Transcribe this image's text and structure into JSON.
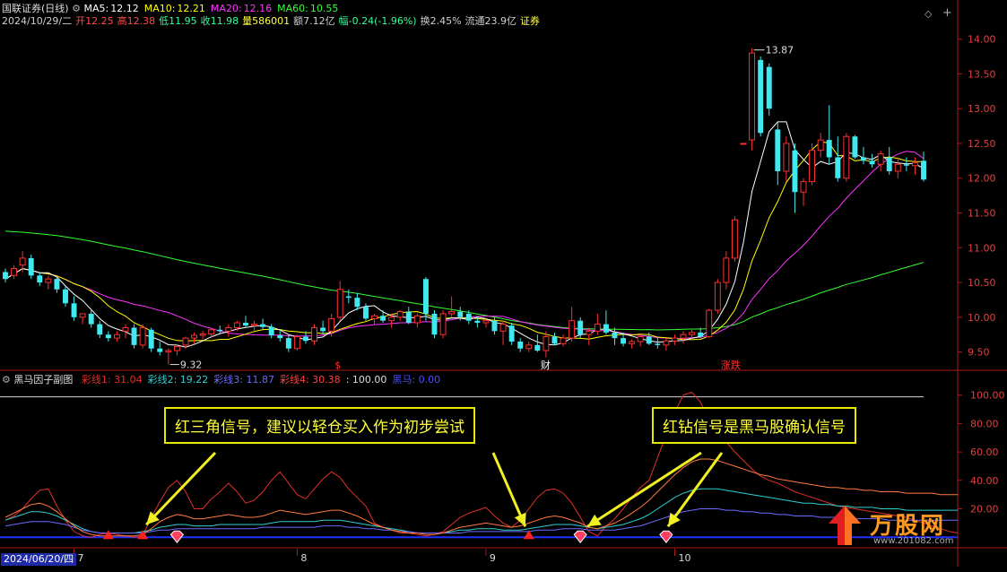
{
  "header": {
    "stock": "国联证券",
    "period": "(日线)",
    "ma": [
      {
        "label": "MA5:",
        "value": "12.12",
        "color": "#ffffff"
      },
      {
        "label": "MA10:",
        "value": "12.21",
        "color": "#ffff00"
      },
      {
        "label": "MA20:",
        "value": "12.16",
        "color": "#ff33ff"
      },
      {
        "label": "MA60:",
        "value": "10.55",
        "color": "#33ff33"
      }
    ],
    "info": [
      {
        "text": "2024/10/29/二",
        "color": "#cfcfcf"
      },
      {
        "text": "开12.25",
        "color": "#ff4a4a"
      },
      {
        "text": "高12.38",
        "color": "#ff4a4a"
      },
      {
        "text": "低11.95",
        "color": "#33ff99"
      },
      {
        "text": "收11.98",
        "color": "#33ff99"
      },
      {
        "text": "量586001",
        "color": "#ffff44"
      },
      {
        "text": "额7.12亿",
        "color": "#cfcfcf"
      },
      {
        "text": "幅-0.24(-1.96%)",
        "color": "#33ff99"
      },
      {
        "text": "换2.45%",
        "color": "#cfcfcf"
      },
      {
        "text": "流通23.9亿",
        "color": "#cfcfcf"
      },
      {
        "text": "证券",
        "color": "#ffff44"
      }
    ]
  },
  "sub_header": {
    "title": "黑马因子副图",
    "items": [
      {
        "text": "彩线1: 31.04",
        "color": "#e0302a"
      },
      {
        "text": "彩线2: 19.22",
        "color": "#2fd0d0"
      },
      {
        "text": "彩线3: 11.87",
        "color": "#6a6aff"
      },
      {
        "text": "彩线4: 30.38",
        "color": "#ff4040"
      },
      {
        "text": ": 100.00",
        "color": "#dddddd"
      },
      {
        "text": "黑马: 0.00",
        "color": "#4a4aff"
      }
    ]
  },
  "annotations": {
    "left": "红三角信号，建议以轻仓买入作为初步尝试",
    "right": "红钻信号是黑马股确认信号"
  },
  "date_axis": {
    "start": "2024/06/20/四",
    "months": [
      "7",
      "8",
      "9",
      "10"
    ]
  },
  "markers": {
    "low_label": "9.32",
    "high_label": "13.87",
    "event_s": "$",
    "event_cai": "财",
    "event_zd": "涨跌"
  },
  "watermark": {
    "brand": "万股网",
    "url": "www.201082.com"
  },
  "controls": {
    "diamond": "◇",
    "plus": "+"
  },
  "colors": {
    "up": "#ff3030",
    "down": "#40e8f0",
    "ma5": "#ffffff",
    "ma10": "#ffff00",
    "ma20": "#ff33ff",
    "ma60": "#33ff33",
    "axis": "#b01818"
  },
  "chart_data": [
    {
      "type": "candlestick",
      "title": "国联证券 (日线)",
      "ylim": [
        9.25,
        14.15
      ],
      "y_ticks": [
        9.5,
        10.0,
        10.5,
        11.0,
        11.5,
        12.0,
        12.5,
        13.0,
        13.5,
        14.0
      ],
      "ohlc": [
        [
          10.65,
          10.7,
          10.5,
          10.55
        ],
        [
          10.6,
          10.75,
          10.55,
          10.7
        ],
        [
          10.75,
          10.95,
          10.65,
          10.85
        ],
        [
          10.85,
          10.9,
          10.55,
          10.6
        ],
        [
          10.6,
          10.65,
          10.45,
          10.5
        ],
        [
          10.5,
          10.6,
          10.4,
          10.55
        ],
        [
          10.55,
          10.6,
          10.35,
          10.4
        ],
        [
          10.4,
          10.45,
          10.15,
          10.2
        ],
        [
          10.2,
          10.3,
          9.95,
          10.0
        ],
        [
          10.0,
          10.05,
          9.9,
          10.05
        ],
        [
          10.05,
          10.1,
          9.85,
          9.9
        ],
        [
          9.9,
          9.95,
          9.7,
          9.75
        ],
        [
          9.75,
          9.8,
          9.65,
          9.7
        ],
        [
          9.7,
          9.8,
          9.65,
          9.75
        ],
        [
          9.8,
          9.9,
          9.7,
          9.85
        ],
        [
          9.85,
          9.9,
          9.55,
          9.6
        ],
        [
          9.6,
          9.9,
          9.55,
          9.85
        ],
        [
          9.82,
          9.85,
          9.5,
          9.55
        ],
        [
          9.55,
          9.65,
          9.45,
          9.5
        ],
        [
          9.5,
          9.55,
          9.32,
          9.52
        ],
        [
          9.52,
          9.6,
          9.45,
          9.58
        ],
        [
          9.6,
          9.72,
          9.55,
          9.7
        ],
        [
          9.7,
          9.78,
          9.62,
          9.74
        ],
        [
          9.74,
          9.8,
          9.68,
          9.76
        ],
        [
          9.76,
          9.85,
          9.7,
          9.82
        ],
        [
          9.82,
          9.88,
          9.75,
          9.8
        ],
        [
          9.8,
          9.9,
          9.72,
          9.85
        ],
        [
          9.85,
          9.95,
          9.8,
          9.92
        ],
        [
          9.92,
          10.02,
          9.85,
          9.88
        ],
        [
          9.88,
          9.95,
          9.78,
          9.9
        ],
        [
          9.9,
          9.98,
          9.82,
          9.86
        ],
        [
          9.86,
          9.9,
          9.7,
          9.74
        ],
        [
          9.74,
          9.8,
          9.65,
          9.7
        ],
        [
          9.7,
          9.74,
          9.5,
          9.55
        ],
        [
          9.55,
          9.75,
          9.52,
          9.72
        ],
        [
          9.72,
          9.8,
          9.62,
          9.66
        ],
        [
          9.66,
          9.9,
          9.6,
          9.85
        ],
        [
          9.85,
          9.95,
          9.75,
          9.8
        ],
        [
          9.8,
          10.05,
          9.72,
          9.98
        ],
        [
          10.0,
          10.52,
          9.95,
          10.4
        ],
        [
          10.3,
          10.4,
          10.2,
          10.28
        ],
        [
          10.28,
          10.35,
          10.1,
          10.15
        ],
        [
          10.15,
          10.2,
          9.95,
          9.98
        ],
        [
          9.98,
          10.05,
          9.9,
          10.02
        ],
        [
          10.02,
          10.1,
          9.92,
          9.95
        ],
        [
          9.95,
          10.05,
          9.85,
          10.0
        ],
        [
          10.0,
          10.1,
          9.95,
          10.08
        ],
        [
          10.08,
          10.15,
          9.9,
          9.92
        ],
        [
          9.92,
          10.05,
          9.85,
          10.02
        ],
        [
          10.55,
          10.58,
          9.95,
          10.05
        ],
        [
          10.05,
          10.1,
          9.7,
          9.75
        ],
        [
          9.75,
          10.1,
          9.7,
          10.05
        ],
        [
          10.05,
          10.3,
          10.0,
          10.08
        ],
        [
          10.08,
          10.15,
          9.95,
          10.0
        ],
        [
          10.05,
          10.1,
          9.9,
          9.95
        ],
        [
          9.95,
          10.0,
          9.85,
          9.92
        ],
        [
          9.92,
          9.98,
          9.85,
          9.95
        ],
        [
          9.95,
          10.0,
          9.75,
          9.8
        ],
        [
          9.8,
          9.95,
          9.6,
          9.9
        ],
        [
          9.88,
          9.92,
          9.6,
          9.65
        ],
        [
          9.65,
          9.7,
          9.5,
          9.55
        ],
        [
          9.55,
          9.65,
          9.5,
          9.6
        ],
        [
          9.6,
          9.75,
          9.5,
          9.52
        ],
        [
          9.52,
          9.8,
          9.42,
          9.72
        ],
        [
          9.72,
          9.78,
          9.6,
          9.62
        ],
        [
          9.62,
          9.75,
          9.58,
          9.7
        ],
        [
          9.7,
          10.15,
          9.65,
          9.95
        ],
        [
          9.95,
          10.0,
          9.7,
          9.75
        ],
        [
          9.75,
          9.85,
          9.6,
          9.8
        ],
        [
          9.8,
          10.05,
          9.75,
          9.9
        ],
        [
          9.9,
          10.1,
          9.75,
          9.78
        ],
        [
          9.78,
          9.85,
          9.6,
          9.7
        ],
        [
          9.7,
          9.78,
          9.58,
          9.62
        ],
        [
          9.62,
          9.68,
          9.55,
          9.65
        ],
        [
          9.65,
          9.75,
          9.58,
          9.72
        ],
        [
          9.72,
          9.78,
          9.6,
          9.62
        ],
        [
          9.62,
          9.7,
          9.55,
          9.6
        ],
        [
          9.6,
          9.7,
          9.52,
          9.66
        ],
        [
          9.66,
          9.75,
          9.6,
          9.7
        ],
        [
          9.7,
          9.8,
          9.62,
          9.75
        ],
        [
          9.75,
          9.82,
          9.68,
          9.78
        ],
        [
          9.78,
          9.85,
          9.7,
          9.72
        ],
        [
          9.72,
          10.12,
          9.7,
          10.1
        ],
        [
          10.1,
          10.55,
          10.05,
          10.5
        ],
        [
          10.5,
          10.95,
          10.4,
          10.85
        ],
        [
          10.85,
          11.45,
          10.8,
          11.4
        ],
        [
          12.5,
          12.5,
          12.5,
          12.5
        ],
        [
          12.55,
          13.87,
          12.4,
          13.8
        ],
        [
          13.7,
          13.75,
          12.6,
          12.65
        ],
        [
          13.6,
          13.65,
          12.9,
          13.0
        ],
        [
          12.7,
          12.8,
          11.9,
          12.1
        ],
        [
          12.1,
          12.6,
          11.95,
          12.5
        ],
        [
          12.4,
          12.5,
          11.5,
          11.8
        ],
        [
          11.8,
          12.0,
          11.6,
          11.95
        ],
        [
          11.95,
          12.5,
          11.9,
          12.4
        ],
        [
          12.4,
          12.65,
          12.3,
          12.55
        ],
        [
          12.55,
          13.05,
          12.2,
          12.3
        ],
        [
          12.3,
          12.6,
          11.95,
          12.0
        ],
        [
          12.0,
          12.65,
          11.95,
          12.6
        ],
        [
          12.6,
          12.62,
          12.28,
          12.3
        ],
        [
          12.3,
          12.45,
          12.2,
          12.25
        ],
        [
          12.25,
          12.35,
          12.15,
          12.2
        ],
        [
          12.2,
          12.4,
          12.1,
          12.35
        ],
        [
          12.3,
          12.45,
          12.05,
          12.1
        ],
        [
          12.1,
          12.3,
          12.0,
          12.2
        ],
        [
          12.2,
          12.3,
          12.1,
          12.18
        ],
        [
          12.18,
          12.3,
          12.05,
          12.22
        ],
        [
          12.25,
          12.38,
          11.95,
          11.98
        ]
      ]
    },
    {
      "type": "line",
      "title": "黑马因子副图",
      "ylim": [
        -3,
        108
      ],
      "y_ticks": [
        20,
        40,
        60,
        80,
        100
      ],
      "series": [
        {
          "name": "彩线1",
          "color": "#e0302a",
          "values": [
            12,
            15,
            20,
            27,
            33,
            34,
            22,
            12,
            4,
            1,
            0,
            2,
            3,
            2,
            1,
            0,
            1,
            14,
            25,
            35,
            40,
            32,
            20,
            20,
            27,
            32,
            38,
            32,
            24,
            26,
            32,
            40,
            46,
            38,
            30,
            27,
            34,
            41,
            46,
            42,
            34,
            28,
            22,
            10,
            7,
            5,
            3,
            3,
            2,
            1,
            2,
            4,
            9,
            14,
            17,
            19,
            21,
            15,
            10,
            7,
            12,
            20,
            28,
            33,
            34,
            31,
            24,
            14,
            4,
            1,
            8,
            13,
            20,
            28,
            35,
            40,
            56,
            72,
            88,
            100,
            102,
            95,
            83,
            74,
            67,
            60,
            54,
            48,
            43,
            40,
            38,
            35,
            32,
            30,
            28,
            26,
            24,
            22,
            21,
            20,
            19,
            18,
            17,
            16,
            15,
            14,
            12,
            10,
            8,
            6,
            4,
            3
          ]
        },
        {
          "name": "彩线2",
          "color": "#2fd0d0",
          "values": [
            12,
            14,
            16,
            18,
            18,
            17,
            15,
            12,
            9,
            6,
            4,
            3,
            3,
            3,
            3,
            3,
            4,
            5,
            7,
            8,
            9,
            9,
            8,
            8,
            8,
            9,
            9,
            9,
            9,
            9,
            9,
            10,
            11,
            11,
            11,
            11,
            11,
            12,
            12,
            12,
            11,
            10,
            9,
            8,
            7,
            6,
            5,
            4,
            3,
            3,
            3,
            3,
            4,
            5,
            5,
            6,
            6,
            6,
            5,
            5,
            5,
            6,
            7,
            8,
            9,
            9,
            9,
            8,
            7,
            6,
            7,
            8,
            9,
            11,
            13,
            16,
            20,
            24,
            28,
            31,
            33,
            34,
            34,
            34,
            33,
            32,
            31,
            30,
            29,
            28,
            27,
            26,
            25,
            24,
            24,
            23,
            23,
            22,
            22,
            21,
            21,
            21,
            20,
            20,
            20,
            19,
            19,
            19,
            19,
            19,
            19,
            19
          ]
        },
        {
          "name": "彩线3",
          "color": "#6a6aff",
          "values": [
            8,
            9,
            10,
            11,
            11,
            11,
            10,
            9,
            7,
            5,
            4,
            3,
            3,
            3,
            3,
            3,
            3,
            4,
            5,
            5,
            6,
            6,
            6,
            6,
            6,
            6,
            6,
            6,
            6,
            6,
            7,
            7,
            7,
            7,
            7,
            7,
            7,
            8,
            8,
            8,
            7,
            7,
            6,
            6,
            5,
            5,
            4,
            4,
            3,
            3,
            3,
            3,
            3,
            3,
            4,
            4,
            4,
            4,
            4,
            4,
            4,
            4,
            5,
            5,
            5,
            6,
            6,
            6,
            5,
            5,
            5,
            5,
            6,
            7,
            8,
            10,
            12,
            14,
            16,
            18,
            19,
            20,
            20,
            20,
            19,
            19,
            18,
            18,
            17,
            17,
            16,
            16,
            15,
            15,
            15,
            14,
            14,
            14,
            13,
            13,
            13,
            13,
            13,
            12,
            12,
            12,
            12,
            12,
            12,
            12,
            12,
            12
          ]
        },
        {
          "name": "彩线4",
          "color": "#ff7a40",
          "values": [
            14,
            17,
            20,
            23,
            24,
            22,
            18,
            13,
            8,
            4,
            2,
            1,
            1,
            1,
            1,
            1,
            2,
            6,
            11,
            14,
            16,
            15,
            13,
            13,
            14,
            15,
            16,
            15,
            14,
            14,
            15,
            17,
            19,
            18,
            17,
            16,
            17,
            18,
            19,
            19,
            17,
            15,
            12,
            9,
            7,
            5,
            4,
            3,
            3,
            2,
            2,
            3,
            5,
            7,
            8,
            9,
            10,
            9,
            8,
            7,
            8,
            10,
            12,
            14,
            15,
            14,
            12,
            10,
            7,
            6,
            8,
            10,
            13,
            17,
            21,
            26,
            32,
            38,
            44,
            49,
            53,
            55,
            55,
            54,
            52,
            50,
            48,
            46,
            44,
            43,
            41,
            40,
            39,
            38,
            37,
            36,
            35,
            35,
            34,
            34,
            33,
            33,
            32,
            32,
            32,
            31,
            31,
            31,
            31,
            30,
            30,
            30
          ]
        }
      ],
      "reference_line": 100,
      "red_triangle_days": [
        12,
        16,
        61
      ],
      "red_diamond_days": [
        20,
        67,
        77
      ]
    }
  ]
}
